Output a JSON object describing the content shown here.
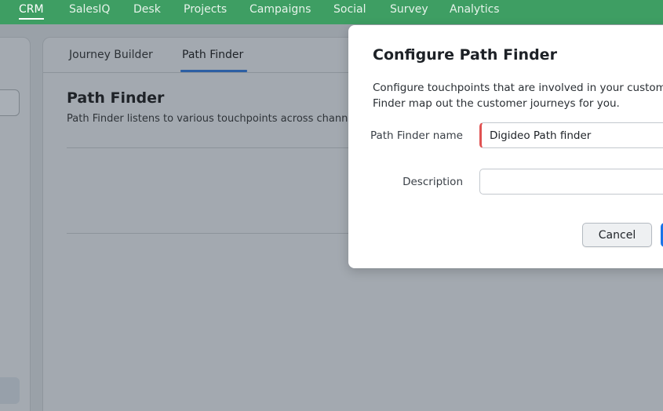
{
  "topnav": {
    "items": [
      {
        "label": "CRM"
      },
      {
        "label": "SalesIQ"
      },
      {
        "label": "Desk"
      },
      {
        "label": "Projects"
      },
      {
        "label": "Campaigns"
      },
      {
        "label": "Social"
      },
      {
        "label": "Survey"
      },
      {
        "label": "Analytics"
      }
    ],
    "active": "CRM"
  },
  "tabs": [
    {
      "label": "Journey Builder"
    },
    {
      "label": "Path Finder"
    }
  ],
  "active_tab": "Path Finder",
  "page": {
    "title": "Path Finder",
    "subtitle": "Path Finder listens to various touchpoints across channe"
  },
  "modal": {
    "title": "Configure Path Finder",
    "description_line1": "Configure touchpoints that are involved in your customer",
    "description_line2": "Finder map out the customer journeys for you.",
    "name_label": "Path Finder name",
    "name_value": "Digideo Path finder",
    "description_label": "Description",
    "description_value": "",
    "cancel_label": "Cancel"
  },
  "colors": {
    "nav_green": "#3e9e63",
    "accent_blue": "#1a73e8",
    "required_red": "#e05252"
  }
}
